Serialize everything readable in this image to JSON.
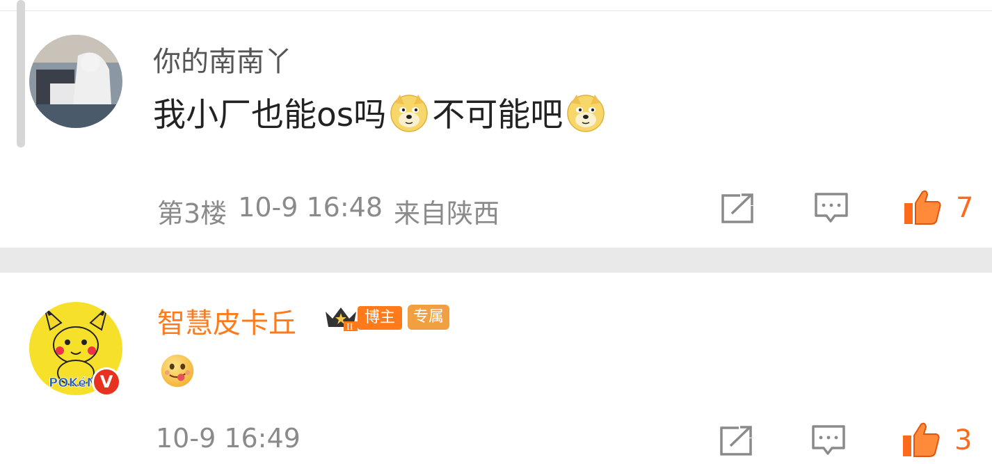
{
  "comments": [
    {
      "username": "你的南南丫",
      "text_parts": [
        "我小厂也能os吗",
        "不可能吧"
      ],
      "floor": "第3楼",
      "time": "10-9 16:48",
      "location": "来自陕西",
      "likes": "7",
      "emoji": "doge-icon"
    },
    {
      "username": "智慧皮卡丘",
      "badge_blogger": "博主",
      "badge_exclusive": "专属",
      "avatar_badge": "V",
      "time": "10-9 16:49",
      "likes": "3",
      "emoji": "tongue-face-icon"
    }
  ],
  "colors": {
    "accent": "#ff6a1a",
    "username_vip": "#ff7a1a",
    "meta_text": "#8a8a8a",
    "separator": "#e9e9e9"
  }
}
